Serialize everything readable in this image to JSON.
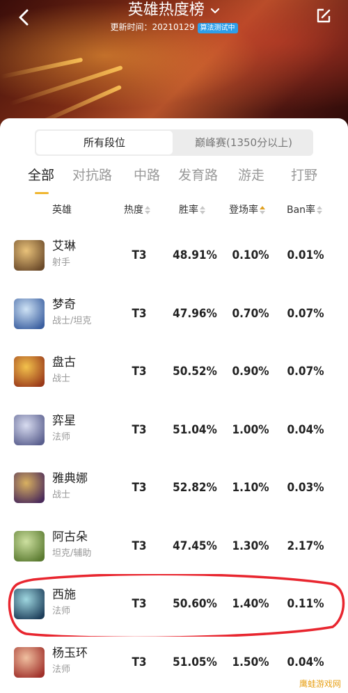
{
  "header": {
    "title": "英雄热度榜",
    "update_label": "更新时间：",
    "update_date": "20210129",
    "badge": "算法测试中"
  },
  "segment": {
    "active": "所有段位",
    "inactive": "巅峰赛(1350分以上)"
  },
  "tabs": [
    "全部",
    "对抗路",
    "中路",
    "发育路",
    "游走",
    "打野"
  ],
  "active_tab": "全部",
  "columns": {
    "hero": "英雄",
    "heat": "热度",
    "win": "胜率",
    "appear": "登场率",
    "ban": "Ban率"
  },
  "rows": [
    {
      "name": "艾琳",
      "role": "射手",
      "heat": "T3",
      "win": "48.91%",
      "appear": "0.10%",
      "ban": "0.01%",
      "color1": "#e9c27a",
      "color2": "#6b4a2a"
    },
    {
      "name": "梦奇",
      "role": "战士/坦克",
      "heat": "T3",
      "win": "47.96%",
      "appear": "0.70%",
      "ban": "0.07%",
      "color1": "#cfe3f5",
      "color2": "#3b5fa0"
    },
    {
      "name": "盘古",
      "role": "战士",
      "heat": "T3",
      "win": "50.52%",
      "appear": "0.90%",
      "ban": "0.07%",
      "color1": "#f3c24c",
      "color2": "#9a3a1a"
    },
    {
      "name": "弈星",
      "role": "法师",
      "heat": "T3",
      "win": "51.04%",
      "appear": "1.00%",
      "ban": "0.04%",
      "color1": "#d8dcf0",
      "color2": "#5a5f8e"
    },
    {
      "name": "雅典娜",
      "role": "战士",
      "heat": "T3",
      "win": "52.82%",
      "appear": "1.10%",
      "ban": "0.03%",
      "color1": "#d9b160",
      "color2": "#4a2a5a"
    },
    {
      "name": "阿古朵",
      "role": "坦克/辅助",
      "heat": "T3",
      "win": "47.45%",
      "appear": "1.30%",
      "ban": "2.17%",
      "color1": "#cde0a0",
      "color2": "#5a7a30"
    },
    {
      "name": "西施",
      "role": "法师",
      "heat": "T3",
      "win": "50.60%",
      "appear": "1.40%",
      "ban": "0.11%",
      "color1": "#9fd7e0",
      "color2": "#1d3e5a"
    },
    {
      "name": "杨玉环",
      "role": "法师",
      "heat": "T3",
      "win": "51.05%",
      "appear": "1.50%",
      "ban": "0.04%",
      "color1": "#f0c0a0",
      "color2": "#a0302a"
    }
  ],
  "watermark": "鹰蛙游戏网"
}
